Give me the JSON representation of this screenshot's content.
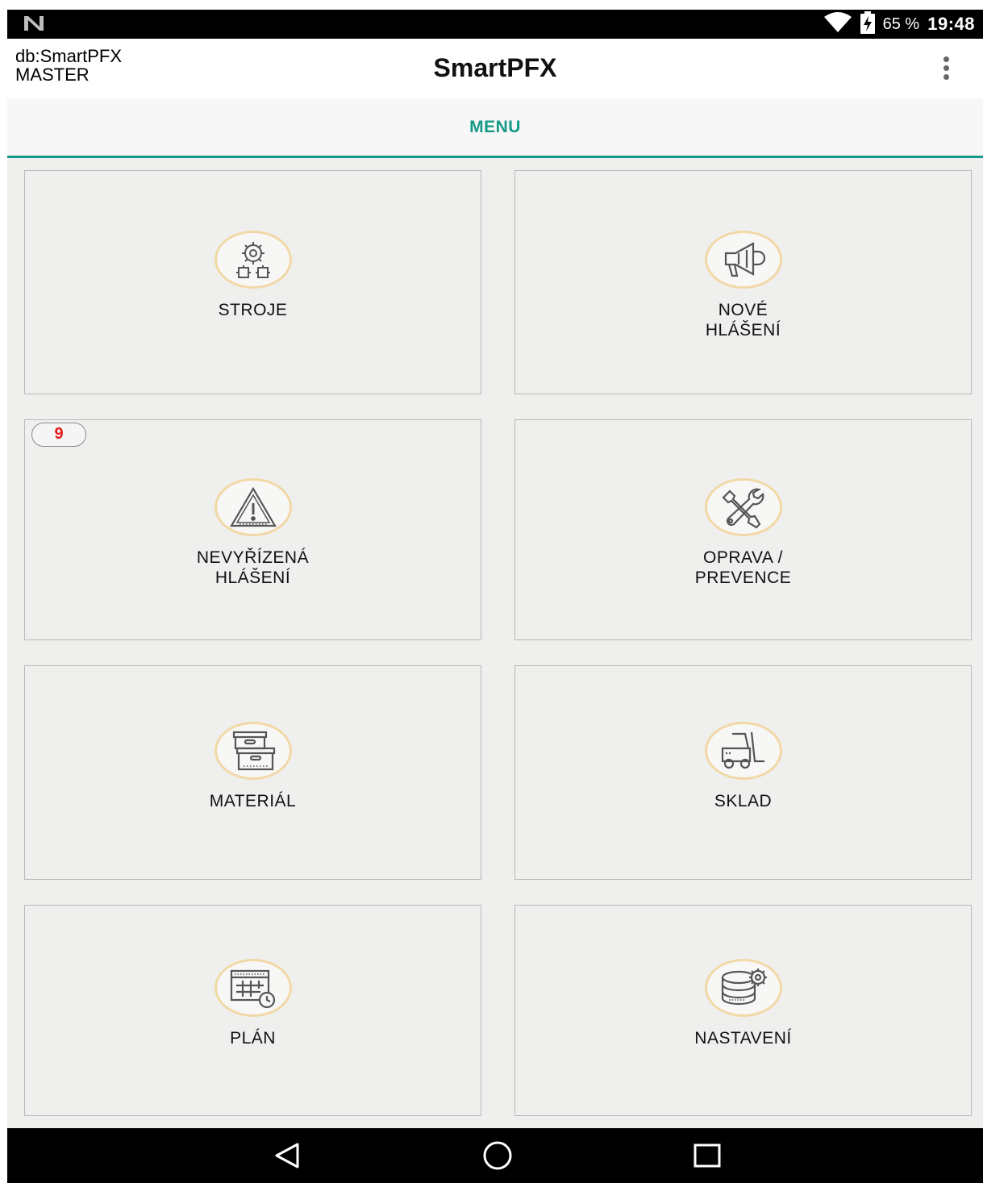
{
  "status_bar": {
    "battery_percent": "65 %",
    "time": "19:48",
    "icons": [
      "notification-n-icon",
      "wifi-icon",
      "battery-charging-icon"
    ]
  },
  "header": {
    "db_line1": "db:SmartPFX",
    "db_line2": "MASTER",
    "title": "SmartPFX",
    "overflow_icon": "more-vert-icon"
  },
  "tabs": [
    {
      "label": "MENU",
      "active": true
    }
  ],
  "accent_color": "#169a88",
  "icon_ring_color": "#f2d8a6",
  "badge_color": "#e51b1b",
  "menu": [
    {
      "id": "stroje",
      "line1": "STROJE",
      "line2": "",
      "icon": "gears-icon"
    },
    {
      "id": "nove-hlaseni",
      "line1": "NOVÉ",
      "line2": "HLÁŠENÍ",
      "icon": "megaphone-icon"
    },
    {
      "id": "nevyrizena-hlaseni",
      "line1": "NEVYŘÍZENÁ",
      "line2": "HLÁŠENÍ",
      "icon": "warning-icon",
      "badge": "9"
    },
    {
      "id": "oprava-prevence",
      "line1": "OPRAVA /",
      "line2": "PREVENCE",
      "icon": "tools-icon"
    },
    {
      "id": "material",
      "line1": "MATERIÁL",
      "line2": "",
      "icon": "boxes-icon"
    },
    {
      "id": "sklad",
      "line1": "SKLAD",
      "line2": "",
      "icon": "forklift-icon"
    },
    {
      "id": "plan",
      "line1": "PLÁN",
      "line2": "",
      "icon": "calendar-clock-icon"
    },
    {
      "id": "nastaveni",
      "line1": "NASTAVENÍ",
      "line2": "",
      "icon": "database-settings-icon"
    }
  ],
  "nav_bar": [
    "back-icon",
    "home-icon",
    "recents-icon"
  ]
}
